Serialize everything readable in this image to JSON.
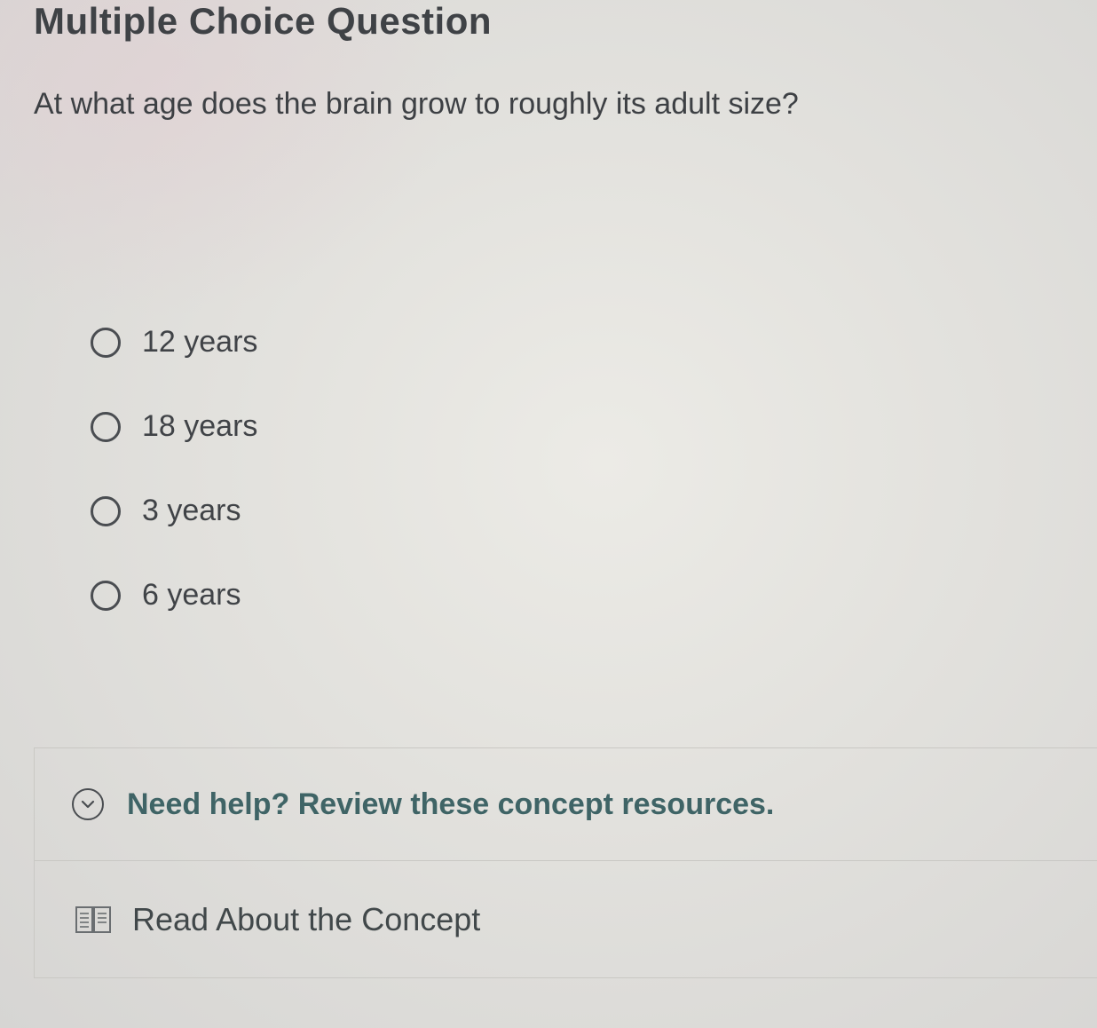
{
  "header": {
    "title": "Multiple Choice Question"
  },
  "question": {
    "text": "At what age does the brain grow to roughly its adult size?"
  },
  "options": [
    {
      "label": "12 years",
      "selected": false
    },
    {
      "label": "18 years",
      "selected": false
    },
    {
      "label": "3 years",
      "selected": false
    },
    {
      "label": "6 years",
      "selected": false
    }
  ],
  "help": {
    "toggle_label": "Need help? Review these concept resources.",
    "icon": "chevron-down-circle-icon"
  },
  "resources": [
    {
      "label": "Read About the Concept",
      "icon": "book-icon"
    }
  ],
  "colors": {
    "help_text": "#3f6466",
    "text": "#3d4044"
  }
}
